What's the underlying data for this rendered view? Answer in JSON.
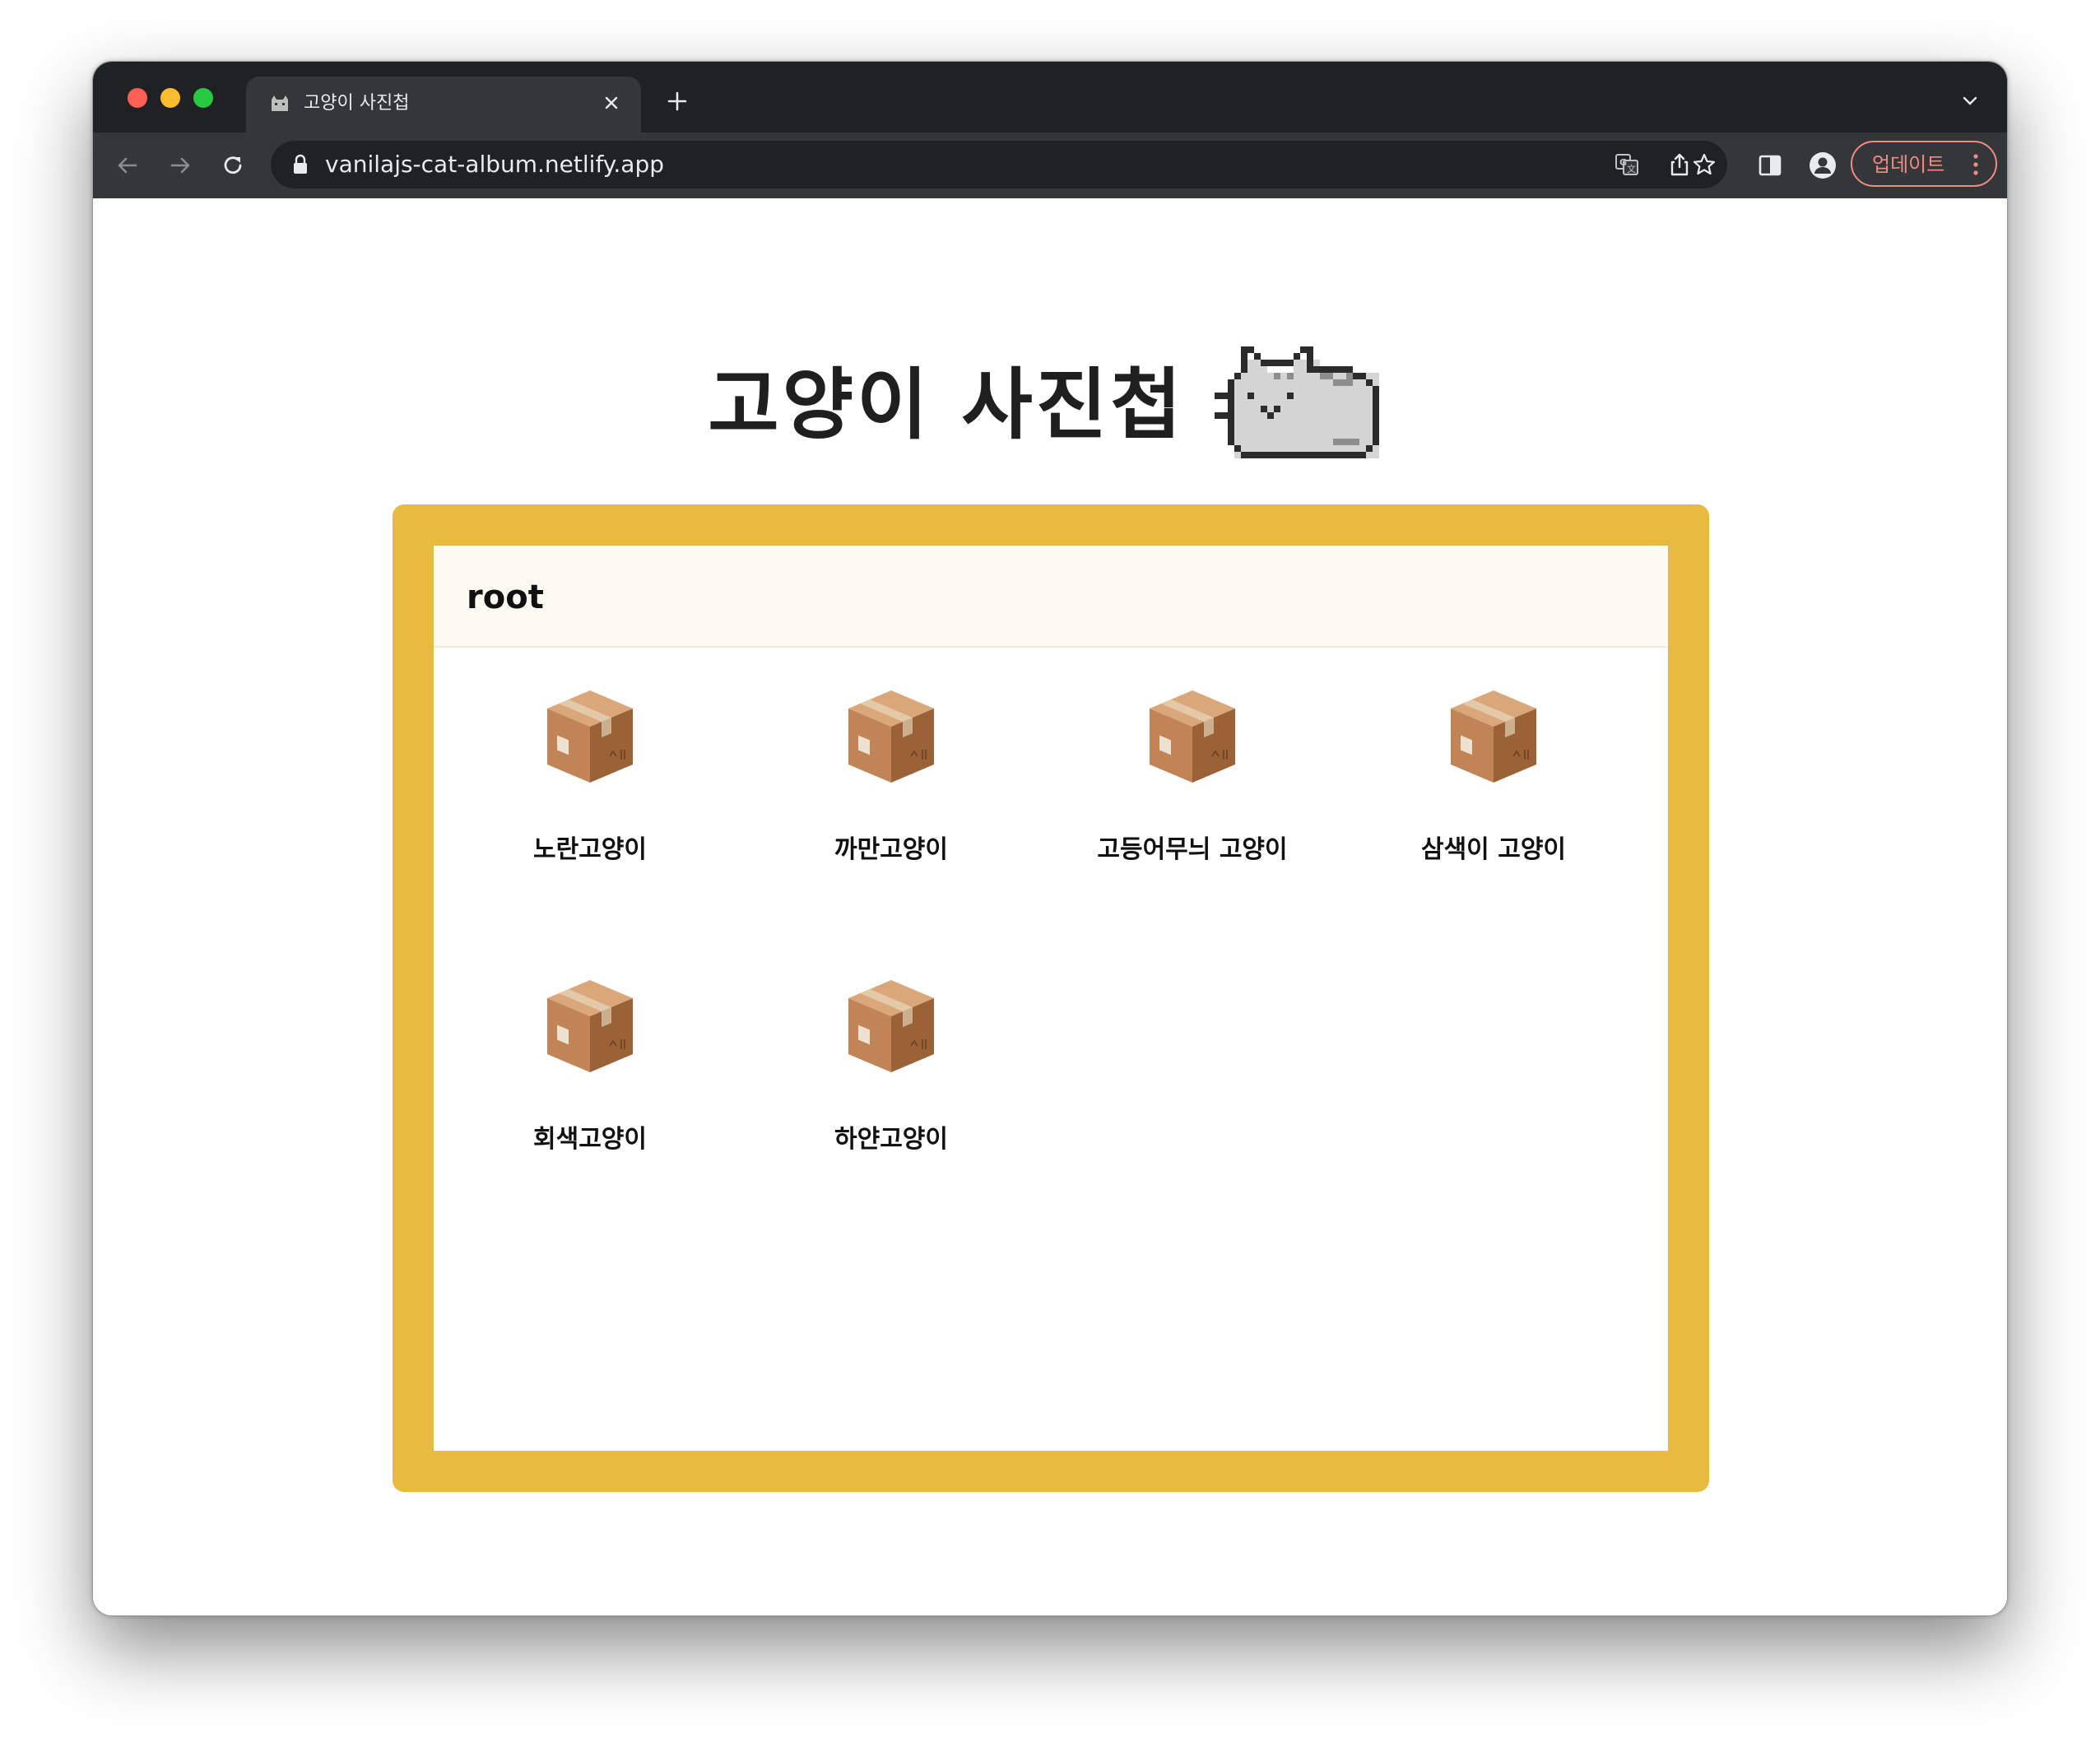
{
  "browser": {
    "tab": {
      "title": "고양이 사진첩",
      "favicon_icon": "cat-icon",
      "close_icon": "close-icon"
    },
    "new_tab_icon": "plus-icon",
    "tab_list_icon": "chevron-down-icon",
    "omnibox": {
      "url": "vanilajs-cat-album.netlify.app",
      "lock_icon": "lock-icon",
      "translate_icon": "translate-icon",
      "share_icon": "share-icon",
      "bookmark_icon": "star-icon"
    },
    "side_panel_icon": "side-panel-icon",
    "profile_icon": "profile-icon",
    "update_label": "업데이트",
    "menu_icon": "kebab-menu-icon",
    "colors": {
      "frame": "#202124",
      "toolbar": "#35363a",
      "update_accent": "#f28b82"
    }
  },
  "page": {
    "title": "고양이 사진첩",
    "title_icon": "pixel-cat-icon",
    "breadcrumb": [
      "root"
    ],
    "nodes": [
      {
        "name": "노란고양이",
        "type": "directory",
        "icon": "box-icon"
      },
      {
        "name": "까만고양이",
        "type": "directory",
        "icon": "box-icon"
      },
      {
        "name": "고등어무늬 고양이",
        "type": "directory",
        "icon": "box-icon"
      },
      {
        "name": "삼색이 고양이",
        "type": "directory",
        "icon": "box-icon"
      },
      {
        "name": "회색고양이",
        "type": "directory",
        "icon": "box-icon"
      },
      {
        "name": "하얀고양이",
        "type": "directory",
        "icon": "box-icon"
      }
    ],
    "colors": {
      "frame": "#e8bb40",
      "breadcrumb_bg": "#fdfaf2",
      "box_main": "#c08457",
      "box_tape": "#e4c9a8"
    }
  }
}
